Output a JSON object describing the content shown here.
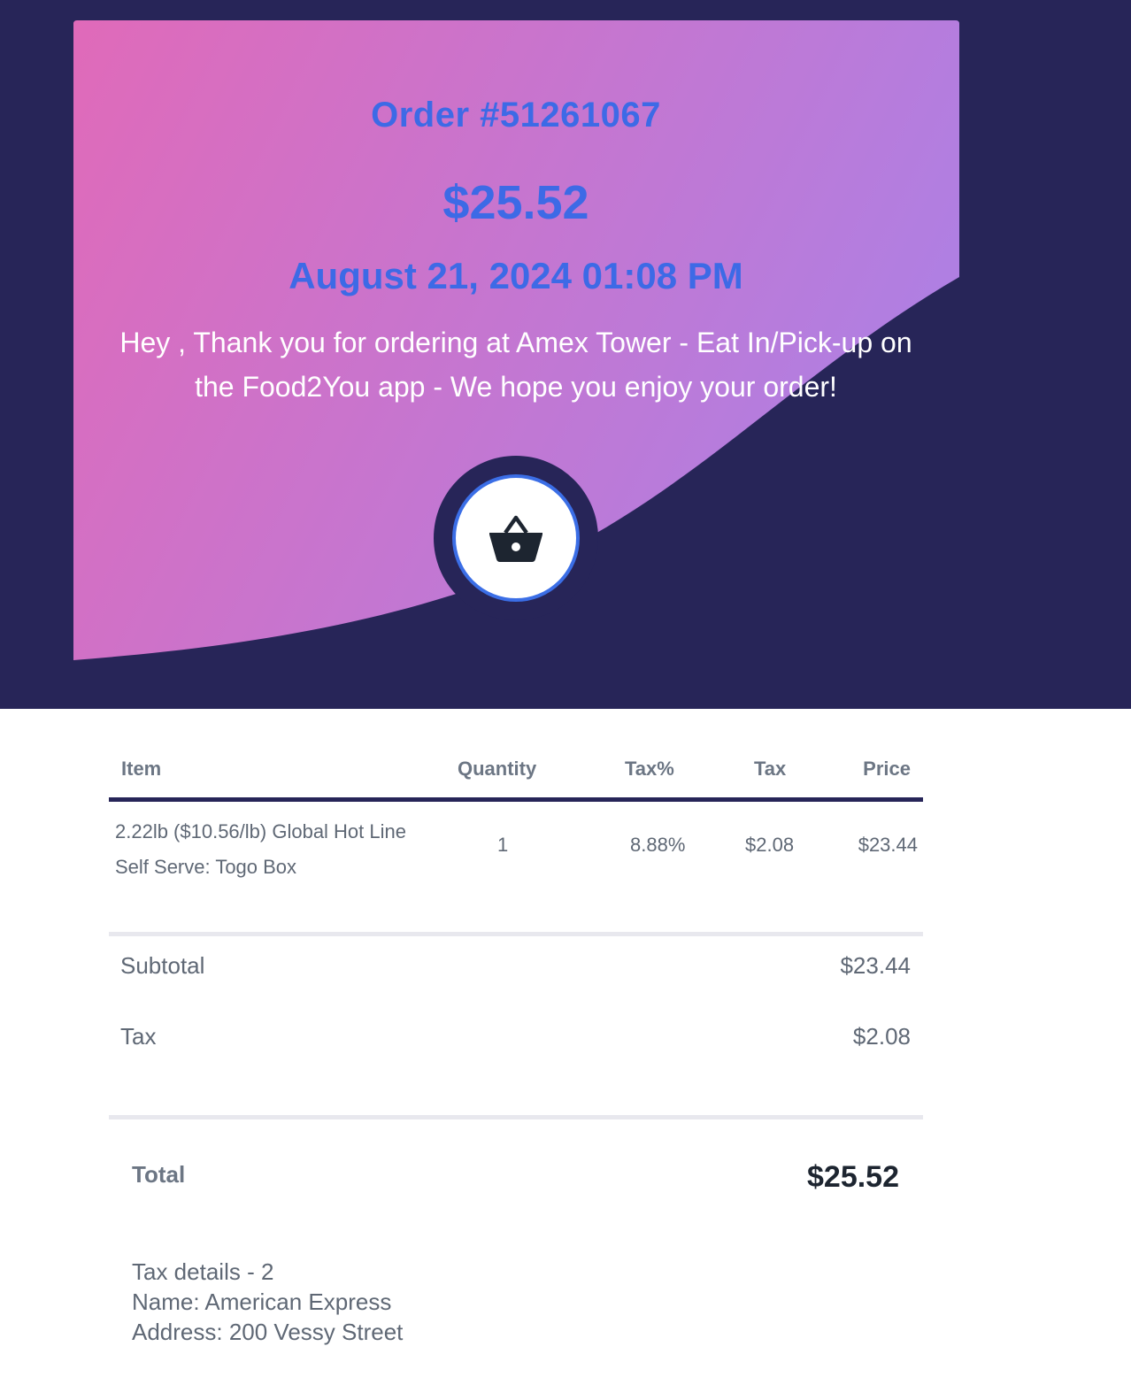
{
  "header": {
    "order_title": "Order #51261067",
    "amount": "$25.52",
    "date": "August 21, 2024 01:08 PM",
    "message": "Hey , Thank you for ordering at Amex Tower - Eat In/Pick-up on the Food2You app - We hope you enjoy your order!",
    "icon": "basket-icon"
  },
  "table": {
    "headers": {
      "item": "Item",
      "quantity": "Quantity",
      "tax_percent": "Tax%",
      "tax": "Tax",
      "price": "Price"
    },
    "rows": [
      {
        "item": "2.22lb ($10.56/lb) Global Hot Line Self Serve: Togo Box",
        "quantity": "1",
        "tax_percent": "8.88%",
        "tax": "$2.08",
        "price": "$23.44"
      }
    ]
  },
  "summary": {
    "subtotal_label": "Subtotal",
    "subtotal_value": "$23.44",
    "tax_label": "Tax",
    "tax_value": "$2.08",
    "total_label": "Total",
    "total_value": "$25.52"
  },
  "tax_details": {
    "title": "Tax details - 2",
    "name": "Name: American Express",
    "address": "Address: 200 Vessy Street"
  },
  "colors": {
    "navy": "#272558",
    "accent_blue": "#3d6ae6",
    "gradient_start": "#e06ab9",
    "gradient_end": "#b07fe2"
  }
}
